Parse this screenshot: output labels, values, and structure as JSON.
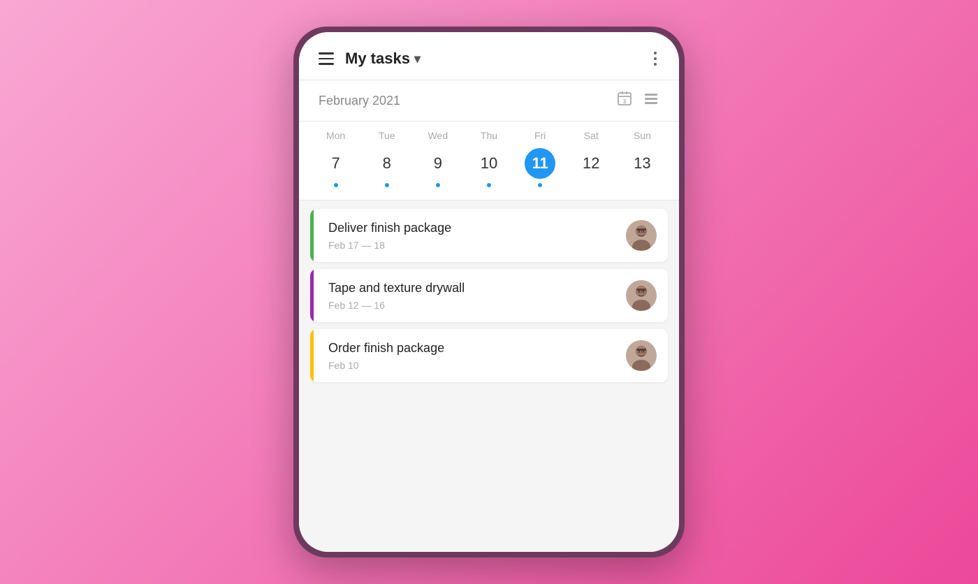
{
  "header": {
    "title": "My tasks",
    "chevron": "▾",
    "menu_icon": "hamburger",
    "more_icon": "three-dots"
  },
  "calendar": {
    "month_title": "February 2021",
    "day_names": [
      "Mon",
      "Tue",
      "Wed",
      "Thu",
      "Fri",
      "Sat",
      "Sun"
    ],
    "days": [
      {
        "num": "7",
        "active": false,
        "dot": true
      },
      {
        "num": "8",
        "active": false,
        "dot": true
      },
      {
        "num": "9",
        "active": false,
        "dot": true
      },
      {
        "num": "10",
        "active": false,
        "dot": true
      },
      {
        "num": "11",
        "active": true,
        "dot": true
      },
      {
        "num": "12",
        "active": false,
        "dot": false
      },
      {
        "num": "13",
        "active": false,
        "dot": false
      }
    ]
  },
  "tasks": [
    {
      "title": "Deliver finish package",
      "date": "Feb 17 — 18",
      "accent": "green"
    },
    {
      "title": "Tape and texture drywall",
      "date": "Feb 12 — 16",
      "accent": "purple"
    },
    {
      "title": "Order finish package",
      "date": "Feb 10",
      "accent": "yellow"
    }
  ]
}
